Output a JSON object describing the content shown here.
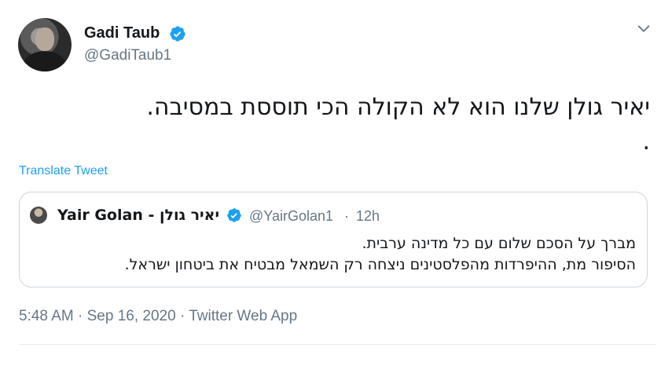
{
  "tweet": {
    "author": {
      "name": "Gadi Taub",
      "handle": "@GadiTaub1",
      "verified": true
    },
    "text_line1": "יאיר גולן שלנו הוא לא הקולה הכי תוססת במסיבה.",
    "text_line2": ".",
    "translate_label": "Translate Tweet",
    "menu_icon": "chevron-down-icon",
    "quoted": {
      "name": "Yair Golan - יאיר גולן",
      "handle": "@YairGolan1",
      "separator": "·",
      "time": "12h",
      "line1": "מברך על הסכם שלום עם כל מדינה ערבית.",
      "line2": "הסיפור מת, ההיפרדות מהפלסטינים ניצחה רק השמאל מבטיח את ביטחון ישראל."
    },
    "time": "5:48 AM",
    "separator": "·",
    "date": "Sep 16, 2020",
    "source": "Twitter Web App"
  },
  "colors": {
    "accent": "#1da1f2",
    "text": "#14171a",
    "secondary": "#657786",
    "border": "#ccd6dd"
  }
}
